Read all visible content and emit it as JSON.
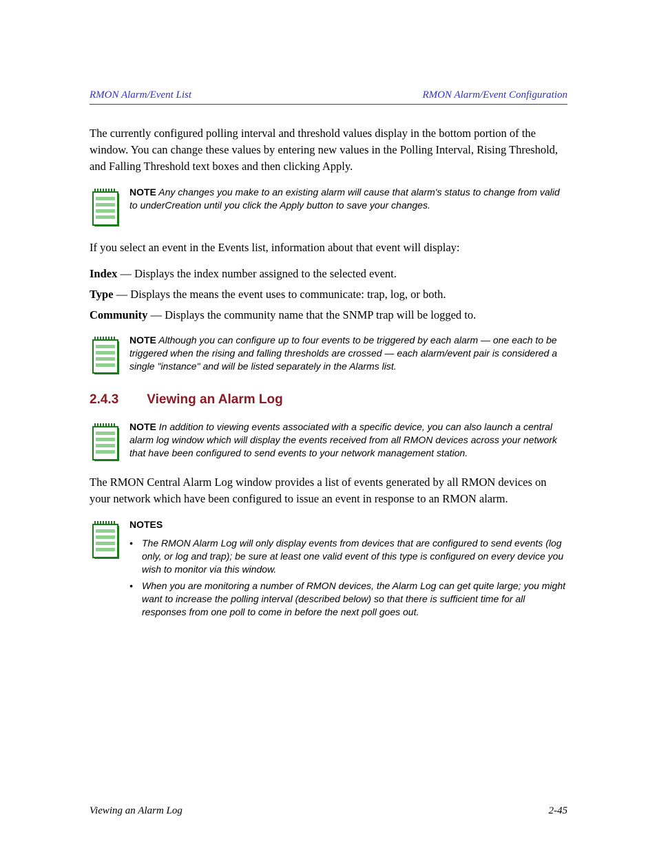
{
  "header": {
    "left": "RMON Alarm/Event List",
    "right": "RMON Alarm/Event Configuration"
  },
  "intro": "The currently configured polling interval and threshold values display in the bottom portion of the window. You can change these values by entering new values in the Polling Interval, Rising Threshold, and Falling Threshold text boxes and then clicking Apply.",
  "notes": [
    {
      "label": "NOTE",
      "text": "Any changes you make to an existing alarm will cause that alarm's status to change from valid to underCreation until you click the Apply button to save your changes."
    },
    {
      "label": "NOTE",
      "text": "Although you can configure up to four events to be triggered by each alarm — one each to be triggered when the rising and falling thresholds are crossed — each alarm/event pair is considered a single \"instance\" and will be listed separately in the Alarms list."
    },
    {
      "label": "NOTE",
      "text": "In addition to viewing events associated with a specific device, you can also launch a central alarm log window which will display the events received from all RMON devices across your network that have been configured to send events to your network management station."
    },
    {
      "label": "NOTES",
      "text_lines": [
        "The RMON Alarm Log will only display events from devices that are configured to send events (log only, or log and trap); be sure at least one valid event of this type is configured on every device you wish to monitor via this window.",
        "When you are monitoring a number of RMON devices, the Alarm Log can get quite large; you might want to increase the polling interval (described below) so that there is sufficient time for all responses from one poll to come in before the next poll goes out."
      ]
    }
  ],
  "paragraphs": {
    "events_intro": "If you select an event in the Events list, information about that event will display:",
    "viewing_intro": "The RMON Central Alarm Log window provides a list of events generated by all RMON devices on your network which have been configured to issue an event in response to an RMON alarm."
  },
  "fields": [
    {
      "name": "Index",
      "desc": "Displays the index number assigned to the selected event."
    },
    {
      "name": "Type",
      "desc": "Displays the means the event uses to communicate: trap, log, or both."
    },
    {
      "name": "Community",
      "desc": "Displays the community name that the SNMP trap will be logged to."
    }
  ],
  "headings": {
    "viewing": {
      "num": "2.4.3",
      "title": "Viewing an Alarm Log"
    }
  },
  "footer": {
    "left": "Viewing an Alarm Log",
    "right": "2-45"
  }
}
